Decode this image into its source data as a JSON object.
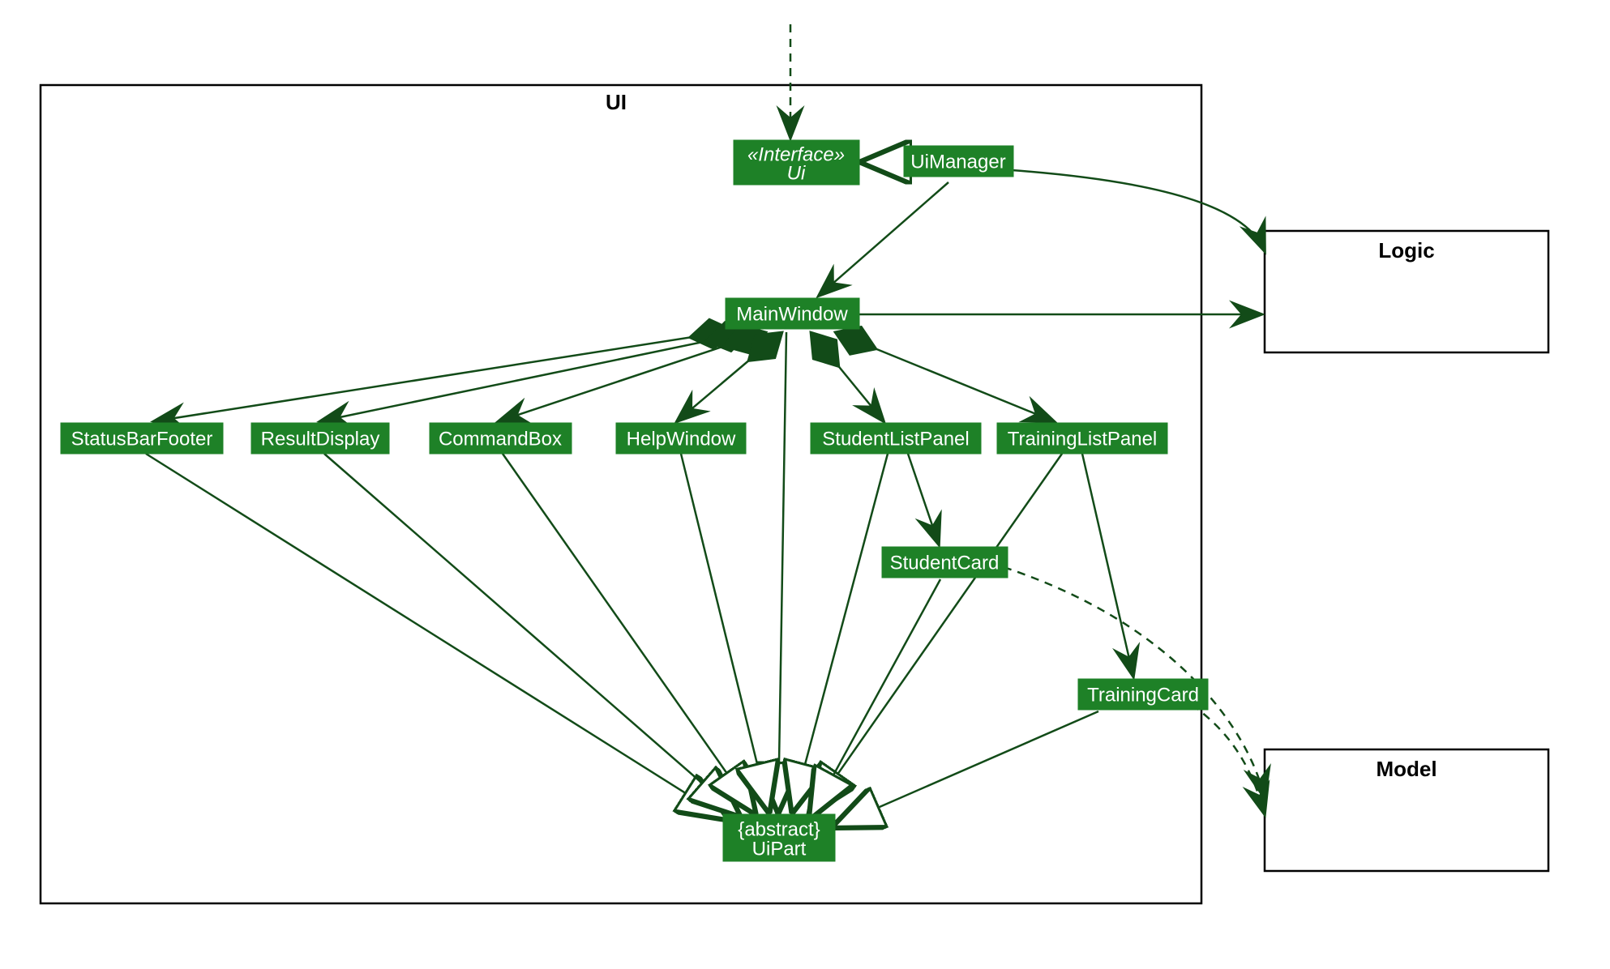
{
  "diagram": {
    "type": "UML class/package diagram",
    "packages": {
      "ui": {
        "label": "UI"
      },
      "logic": {
        "label": "Logic"
      },
      "model": {
        "label": "Model"
      }
    },
    "classes": {
      "ui_interface": {
        "stereotype": "«Interface»",
        "name": "Ui"
      },
      "ui_manager": {
        "name": "UiManager"
      },
      "main_window": {
        "name": "MainWindow"
      },
      "status_bar_footer": {
        "name": "StatusBarFooter"
      },
      "result_display": {
        "name": "ResultDisplay"
      },
      "command_box": {
        "name": "CommandBox"
      },
      "help_window": {
        "name": "HelpWindow"
      },
      "student_list_panel": {
        "name": "StudentListPanel"
      },
      "training_list_panel": {
        "name": "TrainingListPanel"
      },
      "student_card": {
        "name": "StudentCard"
      },
      "training_card": {
        "name": "TrainingCard"
      },
      "ui_part": {
        "stereotype": "{abstract}",
        "name": "UiPart"
      }
    },
    "relationships": [
      {
        "from": "outside",
        "to": "ui_interface",
        "kind": "dependency"
      },
      {
        "from": "ui_manager",
        "to": "ui_interface",
        "kind": "realization"
      },
      {
        "from": "ui_manager",
        "to": "main_window",
        "kind": "association"
      },
      {
        "from": "ui_manager",
        "to": "logic",
        "kind": "association"
      },
      {
        "from": "main_window",
        "to": "logic",
        "kind": "association"
      },
      {
        "from": "main_window",
        "to": "status_bar_footer",
        "kind": "composition"
      },
      {
        "from": "main_window",
        "to": "result_display",
        "kind": "composition"
      },
      {
        "from": "main_window",
        "to": "command_box",
        "kind": "composition"
      },
      {
        "from": "main_window",
        "to": "help_window",
        "kind": "composition"
      },
      {
        "from": "main_window",
        "to": "student_list_panel",
        "kind": "composition"
      },
      {
        "from": "main_window",
        "to": "training_list_panel",
        "kind": "composition"
      },
      {
        "from": "student_list_panel",
        "to": "student_card",
        "kind": "association"
      },
      {
        "from": "training_list_panel",
        "to": "training_card",
        "kind": "association"
      },
      {
        "from": "main_window",
        "to": "ui_part",
        "kind": "generalization"
      },
      {
        "from": "status_bar_footer",
        "to": "ui_part",
        "kind": "generalization"
      },
      {
        "from": "result_display",
        "to": "ui_part",
        "kind": "generalization"
      },
      {
        "from": "command_box",
        "to": "ui_part",
        "kind": "generalization"
      },
      {
        "from": "help_window",
        "to": "ui_part",
        "kind": "generalization"
      },
      {
        "from": "student_list_panel",
        "to": "ui_part",
        "kind": "generalization"
      },
      {
        "from": "training_list_panel",
        "to": "ui_part",
        "kind": "generalization"
      },
      {
        "from": "student_card",
        "to": "ui_part",
        "kind": "generalization"
      },
      {
        "from": "training_card",
        "to": "ui_part",
        "kind": "generalization"
      },
      {
        "from": "student_card",
        "to": "model",
        "kind": "dependency"
      },
      {
        "from": "training_card",
        "to": "model",
        "kind": "dependency"
      }
    ]
  }
}
